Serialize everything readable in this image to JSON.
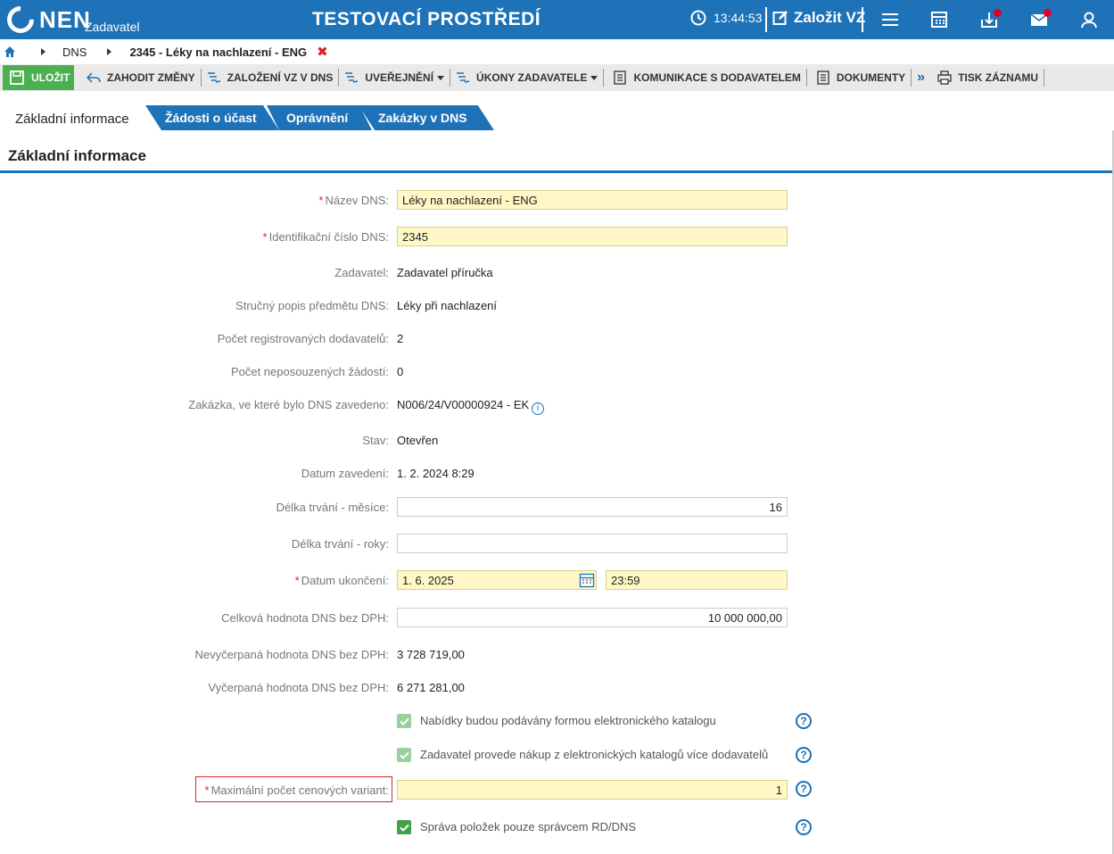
{
  "topbar": {
    "logo_text": "NEN",
    "logo_sub": "Zadavatel",
    "env_title": "TESTOVACÍ PROSTŘEDÍ",
    "clock": "13:44:53",
    "create_label": "Založit VZ",
    "bg_color": "#1d72b8"
  },
  "breadcrumb": {
    "items": [
      "DNS",
      "2345 - Léky na nachlazení - ENG"
    ]
  },
  "toolbar": {
    "save": "ULOŽIT",
    "discard": "ZAHODIT ZMĚNY",
    "create_vz": "ZALOŽENÍ VZ V DNS",
    "publish": "UVEŘEJNĚNÍ",
    "actions": "ÚKONY ZADAVATELE",
    "comm": "KOMUNIKACE S DODAVATELEM",
    "docs": "DOKUMENTY",
    "print": "TISK ZÁZNAMU"
  },
  "tabs": [
    "Základní informace",
    "Žádosti o účast",
    "Oprávnění",
    "Zakázky v DNS"
  ],
  "panel_title": "Základní informace",
  "form": {
    "name_label": "Název DNS:",
    "name_value": "Léky na nachlazení - ENG",
    "id_label": "Identifikační číslo DNS:",
    "id_value": "2345",
    "contracting_label": "Zadavatel:",
    "contracting_value": "Zadavatel příručka",
    "desc_label": "Stručný popis předmětu DNS:",
    "desc_value": "Léky při nachlazení",
    "suppliers_label": "Počet registrovaných dodavatelů:",
    "suppliers_value": "2",
    "pending_label": "Počet neposouzených žádostí:",
    "pending_value": "0",
    "contract_label": "Zakázka, ve které bylo DNS zavedeno:",
    "contract_value": "N006/24/V00000924 - EK",
    "state_label": "Stav:",
    "state_value": "Otevřen",
    "date_label": "Datum zavedení:",
    "date_value": "1. 2. 2024 8:29",
    "months_label": "Délka trvání - měsíce:",
    "months_value": "16",
    "years_label": "Délka trvání - roky:",
    "years_value": "",
    "end_label": "Datum ukončení:",
    "end_date": "1. 6. 2025",
    "end_time": "23:59",
    "total_label": "Celková hodnota DNS bez DPH:",
    "total_value": "10 000 000,00",
    "unspent_label": "Nevyčerpaná hodnota DNS bez DPH:",
    "unspent_value": "3 728 719,00",
    "spent_label": "Vyčerpaná hodnota DNS bez DPH:",
    "spent_value": "6 271 281,00",
    "catalog_label": "Nabídky budou podávány formou elektronického katalogu",
    "multi_label": "Zadavatel provede nákup z elektronických katalogů více dodavatelů",
    "variants_label": "Maximální počet cenových variant:",
    "variants_value": "1",
    "items_label": "Správa položek pouze správcem RD/DNS"
  }
}
